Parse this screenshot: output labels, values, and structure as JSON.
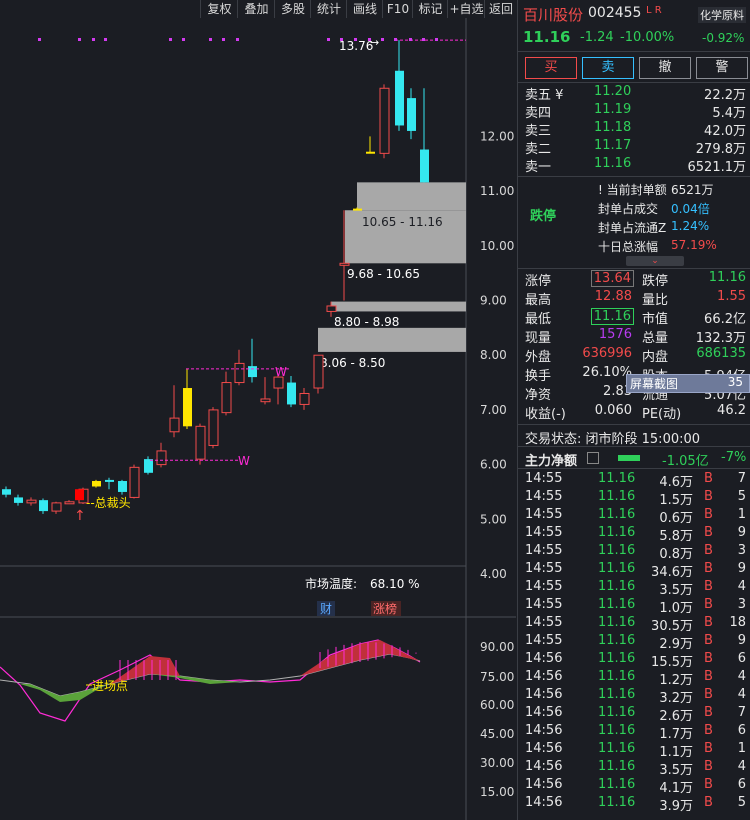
{
  "toolbar": [
    "复权",
    "叠加",
    "多股",
    "统计",
    "画线",
    "F10",
    "标记",
    "+自选",
    "返回"
  ],
  "stock": {
    "name": "百川股份",
    "code": "002455",
    "flags": "L R",
    "price": "11.16",
    "change": "-1.24",
    "change_pct": "-10.00%",
    "sector": "化学原料",
    "sector_pct": "-0.92%"
  },
  "trade_buttons": [
    "买",
    "卖",
    "撤",
    "警"
  ],
  "asks": [
    {
      "label": "卖五 ¥",
      "price": "11.20",
      "vol": "22.2万"
    },
    {
      "label": "卖四",
      "price": "11.19",
      "vol": "5.4万"
    },
    {
      "label": "卖三",
      "price": "11.18",
      "vol": "42.0万"
    },
    {
      "label": "卖二",
      "price": "11.17",
      "vol": "279.8万"
    },
    {
      "label": "卖一",
      "price": "11.16",
      "vol": "6521.1万"
    }
  ],
  "limit": {
    "status": "跌停",
    "rows": [
      {
        "label": "当前封单额",
        "value": "6521万"
      },
      {
        "label": "封单占成交",
        "value": "0.04倍"
      },
      {
        "label": "封单占流通Z",
        "value": "1.24%"
      },
      {
        "label": "十日总涨幅",
        "value": "57.19%"
      }
    ]
  },
  "quote": [
    {
      "l1": "涨停",
      "v1": "13.64",
      "l2": "跌停",
      "v2": "11.16"
    },
    {
      "l1": "最高",
      "v1": "12.88",
      "l2": "量比",
      "v2": "1.55"
    },
    {
      "l1": "最低",
      "v1": "11.16",
      "l2": "市值",
      "v2": "66.2亿"
    },
    {
      "l1": "现量",
      "v1": "1576",
      "l2": "总量",
      "v2": "132.3万"
    },
    {
      "l1": "外盘",
      "v1": "636996",
      "l2": "内盘",
      "v2": "686135"
    },
    {
      "l1": "换手",
      "v1": "26.10%",
      "l2": "股本",
      "v2": "5.94亿"
    },
    {
      "l1": "净资",
      "v1": "2.83",
      "l2": "流通",
      "v2": "5.07亿"
    },
    {
      "l1": "收益(-)",
      "v1": "0.060",
      "l2": "PE(动)",
      "v2": "46.2"
    }
  ],
  "screenshot_tip": {
    "label": "屏幕截图",
    "value": "35"
  },
  "trade_state": "交易状态: 闭市阶段 15:00:00",
  "main_flow": {
    "label": "主力净额",
    "value": "-1.05亿",
    "pct": "-7%"
  },
  "ticks": [
    [
      "14:55",
      "11.16",
      "4.6万",
      "B",
      "7"
    ],
    [
      "14:55",
      "11.16",
      "1.5万",
      "B",
      "5"
    ],
    [
      "14:55",
      "11.16",
      "0.6万",
      "B",
      "1"
    ],
    [
      "14:55",
      "11.16",
      "5.8万",
      "B",
      "9"
    ],
    [
      "14:55",
      "11.16",
      "0.8万",
      "B",
      "3"
    ],
    [
      "14:55",
      "11.16",
      "34.6万",
      "B",
      "9"
    ],
    [
      "14:55",
      "11.16",
      "3.5万",
      "B",
      "4"
    ],
    [
      "14:55",
      "11.16",
      "1.0万",
      "B",
      "3"
    ],
    [
      "14:55",
      "11.16",
      "30.5万",
      "B",
      "18"
    ],
    [
      "14:55",
      "11.16",
      "2.9万",
      "B",
      "9"
    ],
    [
      "14:56",
      "11.16",
      "15.5万",
      "B",
      "6"
    ],
    [
      "14:56",
      "11.16",
      "1.2万",
      "B",
      "4"
    ],
    [
      "14:56",
      "11.16",
      "3.2万",
      "B",
      "4"
    ],
    [
      "14:56",
      "11.16",
      "2.6万",
      "B",
      "7"
    ],
    [
      "14:56",
      "11.16",
      "1.7万",
      "B",
      "6"
    ],
    [
      "14:56",
      "11.16",
      "1.1万",
      "B",
      "1"
    ],
    [
      "14:56",
      "11.16",
      "3.5万",
      "B",
      "4"
    ],
    [
      "14:56",
      "11.16",
      "4.1万",
      "B",
      "6"
    ],
    [
      "14:56",
      "11.16",
      "3.9万",
      "B",
      "5"
    ]
  ],
  "chart": {
    "y_ticks": [
      "12.00",
      "11.00",
      "10.00",
      "9.00",
      "8.00",
      "7.00",
      "6.00",
      "5.00",
      "4.00"
    ],
    "osc_ticks": [
      "90.00",
      "75.00",
      "60.00",
      "45.00",
      "30.00",
      "15.00"
    ],
    "high_label": "13.76",
    "gaps": [
      "10.65 - 11.16",
      "9.68 - 10.65",
      "8.80 - 8.98",
      "8.06 - 8.50"
    ],
    "annotations": [
      "--总裁头",
      "进场点",
      "W",
      "W"
    ],
    "market_temp": {
      "label": "市场温度:",
      "value": "68.10 %"
    },
    "tags": [
      "财",
      "涨榜"
    ]
  }
}
